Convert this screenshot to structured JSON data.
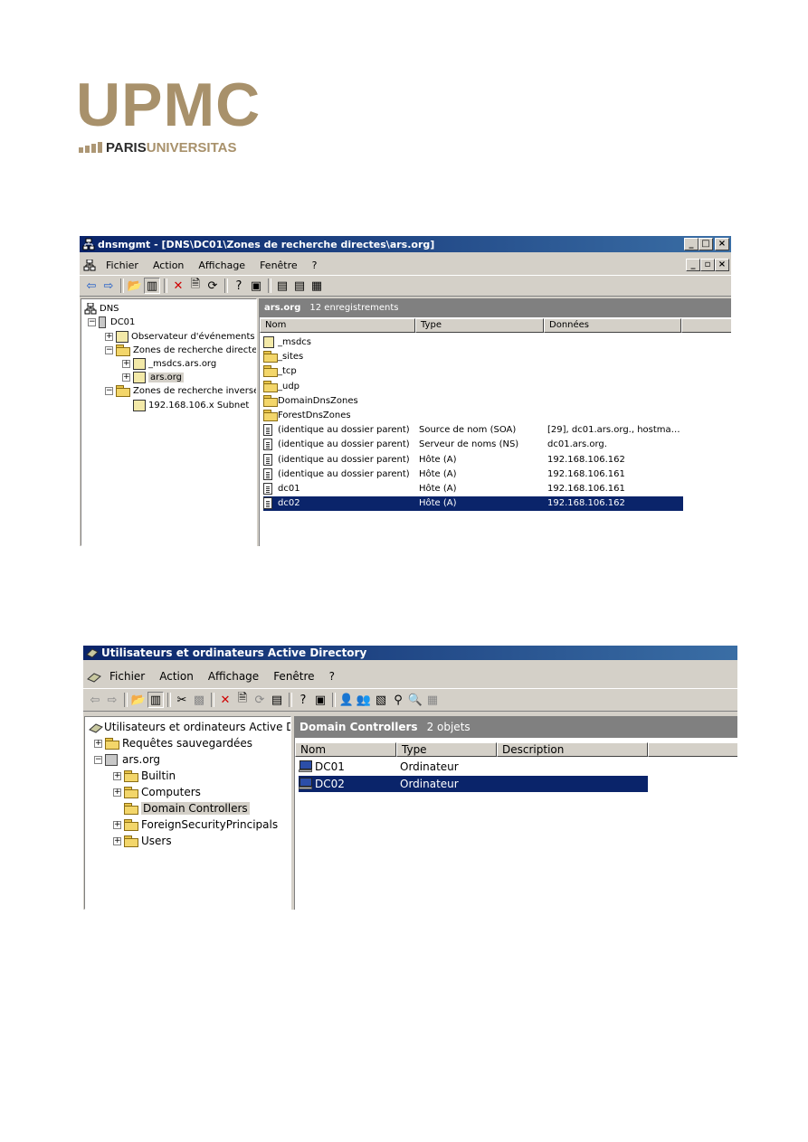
{
  "logo": {
    "brand": "UPMC",
    "paris": "PARIS",
    "universitas": "UNIVERSITAS"
  },
  "dns_window": {
    "title": "dnsmgmt - [DNS\\DC01\\Zones de recherche directes\\ars.org]",
    "menu": [
      "Fichier",
      "Action",
      "Affichage",
      "Fenêtre",
      "?"
    ],
    "tree": [
      {
        "label": "DNS",
        "icon": "dns-icon"
      },
      {
        "label": "DC01",
        "icon": "server-icon"
      },
      {
        "label": "Observateur d'événements",
        "icon": "event-viewer-icon"
      },
      {
        "label": "Zones de recherche directes",
        "icon": "folder-icon"
      },
      {
        "label": "_msdcs.ars.org",
        "icon": "zone-icon"
      },
      {
        "label": "ars.org",
        "icon": "zone-icon"
      },
      {
        "label": "Zones de recherche inversée",
        "icon": "folder-icon"
      },
      {
        "label": "192.168.106.x Subnet",
        "icon": "zone-icon"
      }
    ],
    "list_header": {
      "name": "ars.org",
      "count": "12 enregistrements"
    },
    "columns": [
      "Nom",
      "Type",
      "Données"
    ],
    "rows": [
      {
        "name": "_msdcs",
        "type": "",
        "data": "",
        "icon": "zone-icon"
      },
      {
        "name": "_sites",
        "type": "",
        "data": "",
        "icon": "folder-icon"
      },
      {
        "name": "_tcp",
        "type": "",
        "data": "",
        "icon": "folder-icon"
      },
      {
        "name": "_udp",
        "type": "",
        "data": "",
        "icon": "folder-icon"
      },
      {
        "name": "DomainDnsZones",
        "type": "",
        "data": "",
        "icon": "folder-icon"
      },
      {
        "name": "ForestDnsZones",
        "type": "",
        "data": "",
        "icon": "folder-icon"
      },
      {
        "name": "(identique au dossier parent)",
        "type": "Source de nom (SOA)",
        "data": "[29], dc01.ars.org., hostma…",
        "icon": "record-icon"
      },
      {
        "name": "(identique au dossier parent)",
        "type": "Serveur de noms (NS)",
        "data": "dc01.ars.org.",
        "icon": "record-icon"
      },
      {
        "name": "(identique au dossier parent)",
        "type": "Hôte (A)",
        "data": "192.168.106.162",
        "icon": "record-icon"
      },
      {
        "name": "(identique au dossier parent)",
        "type": "Hôte (A)",
        "data": "192.168.106.161",
        "icon": "record-icon"
      },
      {
        "name": "dc01",
        "type": "Hôte (A)",
        "data": "192.168.106.161",
        "icon": "record-icon"
      },
      {
        "name": "dc02",
        "type": "Hôte (A)",
        "data": "192.168.106.162",
        "icon": "record-icon",
        "selected": true
      }
    ]
  },
  "ad_window": {
    "title": "Utilisateurs et ordinateurs Active Directory",
    "menu": [
      "Fichier",
      "Action",
      "Affichage",
      "Fenêtre",
      "?"
    ],
    "tree": [
      {
        "label": "Utilisateurs et ordinateurs Active Dire"
      },
      {
        "label": "Requêtes sauvegardées"
      },
      {
        "label": "ars.org"
      },
      {
        "label": "Builtin"
      },
      {
        "label": "Computers"
      },
      {
        "label": "Domain Controllers"
      },
      {
        "label": "ForeignSecurityPrincipals"
      },
      {
        "label": "Users"
      }
    ],
    "list_header": {
      "name": "Domain Controllers",
      "count": "2 objets"
    },
    "columns": [
      "Nom",
      "Type",
      "Description"
    ],
    "rows": [
      {
        "name": "DC01",
        "type": "Ordinateur",
        "description": ""
      },
      {
        "name": "DC02",
        "type": "Ordinateur",
        "description": "",
        "selected": true
      }
    ]
  }
}
